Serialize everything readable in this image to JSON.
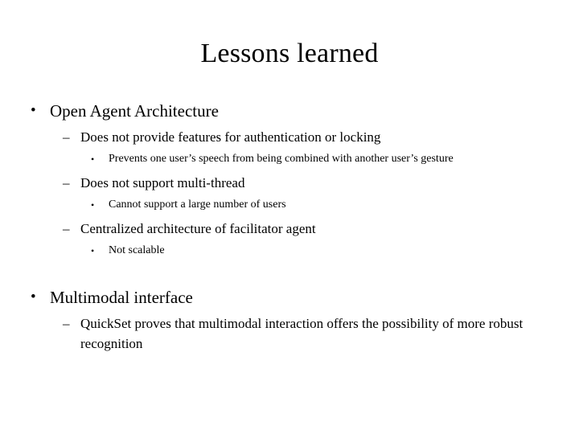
{
  "slide": {
    "title": "Lessons learned",
    "background_color": "#ffffff",
    "text_color": "#000000",
    "bullet_marks": {
      "level1": "•",
      "level2": "–",
      "level3": "•"
    },
    "content": [
      {
        "level": 1,
        "mark": "•",
        "text": "Open Agent Architecture"
      },
      {
        "level": 2,
        "mark": "–",
        "text": "Does not provide features for authentication or locking"
      },
      {
        "level": 3,
        "mark": "•",
        "text": "Prevents one user’s speech from being combined with another user’s gesture"
      },
      {
        "level": 2,
        "mark": "–",
        "text": "Does not support multi-thread"
      },
      {
        "level": 3,
        "mark": "•",
        "text": "Cannot support a large number of users"
      },
      {
        "level": 2,
        "mark": "–",
        "text": "Centralized architecture of facilitator agent"
      },
      {
        "level": 3,
        "mark": "•",
        "text": "Not scalable"
      },
      {
        "level": 1,
        "mark": "•",
        "text": "Multimodal interface"
      },
      {
        "level": 2,
        "mark": "–",
        "text": "QuickSet proves that multimodal interaction offers the possibility of more robust recognition"
      }
    ]
  }
}
